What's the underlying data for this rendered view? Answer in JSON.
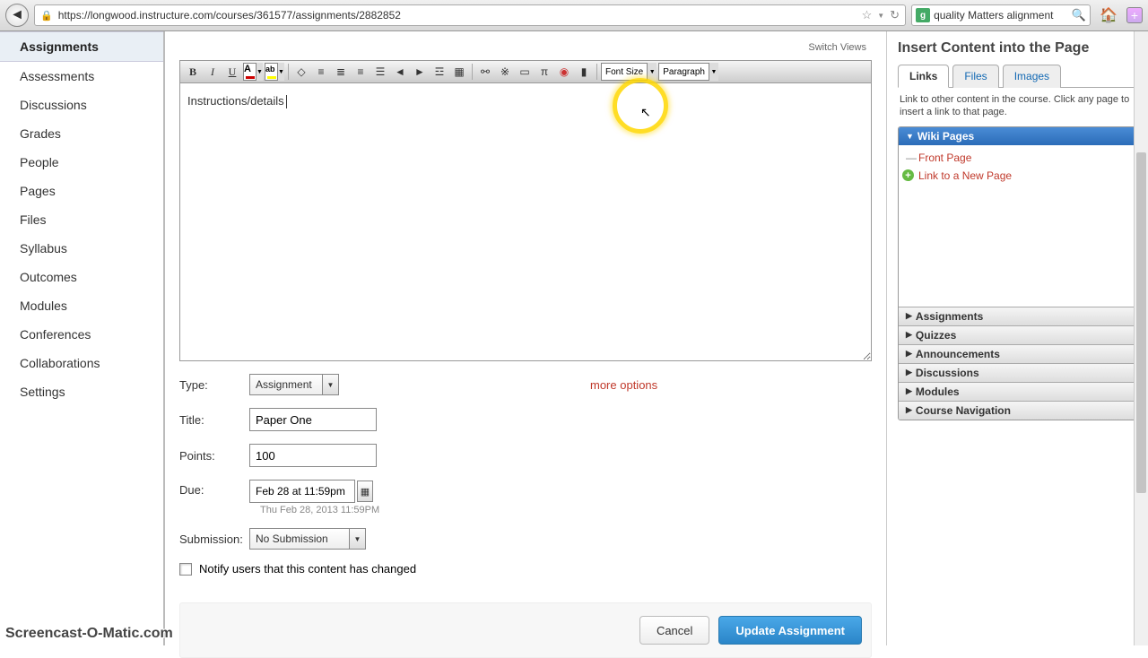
{
  "browser": {
    "url": "https://longwood.instructure.com/courses/361577/assignments/2882852",
    "search": "quality Matters alignment"
  },
  "nav": {
    "items": [
      "Assignments",
      "Assessments",
      "Discussions",
      "Grades",
      "People",
      "Pages",
      "Files",
      "Syllabus",
      "Outcomes",
      "Modules",
      "Conferences",
      "Collaborations",
      "Settings"
    ]
  },
  "editor": {
    "switch_label": "Switch Views",
    "content": "Instructions/details",
    "font_size_label": "Font Size",
    "paragraph_label": "Paragraph"
  },
  "form": {
    "type_label": "Type:",
    "type_value": "Assignment",
    "title_label": "Title:",
    "title_value": "Paper One",
    "points_label": "Points:",
    "points_value": "100",
    "due_label": "Due:",
    "due_value": "Feb 28 at 11:59pm",
    "due_hint": "Thu Feb 28, 2013 11:59PM",
    "submission_label": "Submission:",
    "submission_value": "No Submission",
    "more_options": "more options",
    "notify_label": "Notify users that this content has changed"
  },
  "buttons": {
    "cancel": "Cancel",
    "update": "Update Assignment"
  },
  "right": {
    "title": "Insert Content into the Page",
    "tabs": [
      "Links",
      "Files",
      "Images"
    ],
    "help": "Link to other content in the course. Click any page to insert a link to that page.",
    "wiki_pages_header": "Wiki Pages",
    "wiki_items": [
      "Front Page",
      "Link to a New Page"
    ],
    "collapsed": [
      "Assignments",
      "Quizzes",
      "Announcements",
      "Discussions",
      "Modules",
      "Course Navigation"
    ]
  },
  "watermark": "Screencast-O-Matic.com"
}
